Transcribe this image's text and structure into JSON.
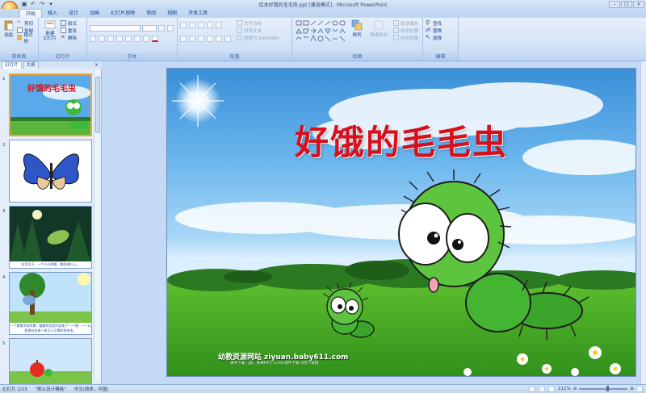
{
  "window": {
    "title": "绘本好饿的毛毛虫.ppt [兼容模式] - Microsoft PowerPoint"
  },
  "tabs": [
    "开始",
    "插入",
    "设计",
    "动画",
    "幻灯片放映",
    "审阅",
    "视图",
    "开发工具"
  ],
  "ribbon": {
    "clipboard": {
      "label": "剪贴板",
      "paste": "粘贴",
      "cut": "剪切",
      "copy": "复制",
      "format_painter": "格式刷"
    },
    "slides": {
      "label": "幻灯片",
      "new_slide": "新建\n幻灯片",
      "layout": "版式",
      "reset": "重设",
      "delete": "删除"
    },
    "font": {
      "label": "字体"
    },
    "paragraph": {
      "label": "段落",
      "text_direction": "文字方向",
      "align_text": "对齐文本",
      "smartart": "转换为 SmartArt"
    },
    "drawing": {
      "label": "绘图",
      "arrange": "排列",
      "quick_styles": "快速样式",
      "shape_fill": "形状填充",
      "shape_outline": "形状轮廓",
      "shape_effects": "形状效果"
    },
    "editing": {
      "label": "编辑",
      "find": "查找",
      "replace": "替换",
      "select": "选择"
    }
  },
  "panel": {
    "tabs": [
      "幻灯片",
      "大纲"
    ],
    "close": "×"
  },
  "thumbnails": [
    {
      "num": "1",
      "caption": ""
    },
    {
      "num": "2",
      "caption": ""
    },
    {
      "num": "3",
      "caption": "在月光下，一个小小的卵，躺在树叶上。"
    },
    {
      "num": "4",
      "caption": "一个星期天的早晨，暖暖的太阳升起来了——啪！——从卵里钻出来一条又小又饿的毛毛虫。"
    },
    {
      "num": "5",
      "caption": ""
    }
  ],
  "slide": {
    "title": "好饿的毛毛虫",
    "site_name": "幼教资源网站  ziyuan.baby611.com",
    "site_sub": "课件下载  儿歌、故事MP3  FLASH课件下载  试卷下载网"
  },
  "status": {
    "slide_info": "幻灯片 1/13",
    "theme": "\"默认设计模板\"",
    "language": "中文(简体，中国)",
    "zoom": "111%"
  },
  "colors": {
    "title_red": "#d7101d",
    "ribbon_blue": "#15428b",
    "selection_orange": "#f2a33b"
  }
}
